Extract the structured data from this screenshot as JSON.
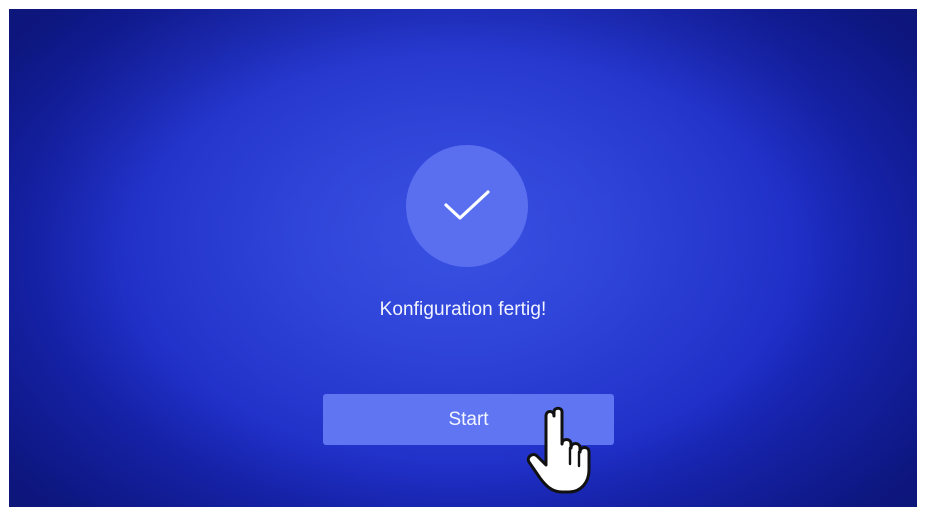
{
  "screen": {
    "icon": "checkmark-icon",
    "title": "Konfiguration fertig!",
    "start_label": "Start",
    "cursor_icon": "hand-pointer-icon"
  },
  "colors": {
    "background": "#1c2bc4",
    "circle": "#5a6ff0",
    "button": "#5f75f2",
    "text": "#f2f4ff"
  }
}
